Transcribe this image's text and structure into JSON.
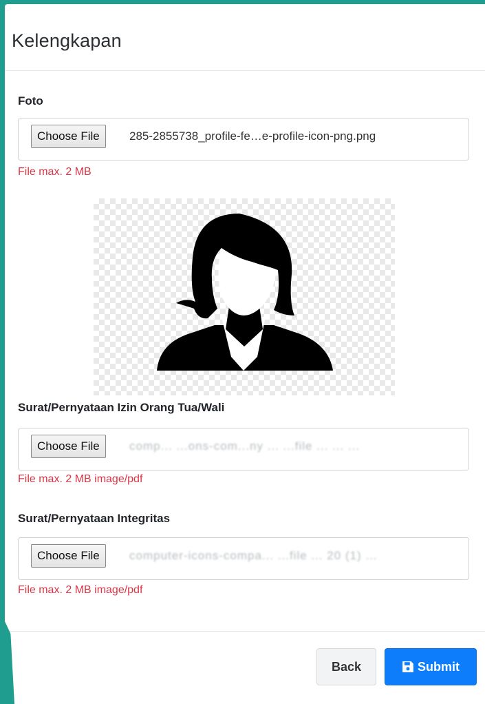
{
  "modal": {
    "title": "Kelengkapan"
  },
  "foto": {
    "label": "Foto",
    "button_label": "Choose File",
    "file_name": "285-2855738_profile-fe…e-profile-icon-png.png",
    "help": "File max. 2 MB"
  },
  "izin": {
    "label": "Surat/Pernyataan Izin Orang Tua/Wali",
    "button_label": "Choose File",
    "file_name": "comp...  ...ons-com...ny ...  ...file ... ... ...",
    "help": "File max. 2 MB image/pdf"
  },
  "integritas": {
    "label": "Surat/Pernyataan Integritas",
    "button_label": "Choose File",
    "file_name": "computer-icons-compa...          ...file ... 20 (1) ...",
    "help": "File max. 2 MB image/pdf"
  },
  "footer": {
    "back_label": "Back",
    "submit_label": "Submit"
  },
  "icons": {
    "submit": "floppy-disk-icon",
    "preview": "female-profile-silhouette-icon"
  },
  "colors": {
    "accent": "#1f9e8f",
    "primary": "#0d7dfc",
    "danger": "#dc3545"
  }
}
